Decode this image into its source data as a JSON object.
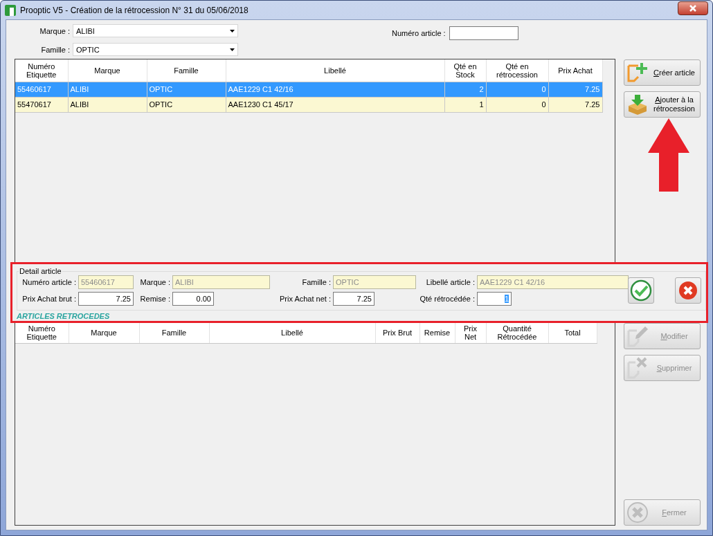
{
  "window": {
    "title": "Prooptic V5 - Création de la rétrocession N° 31 du 05/06/2018"
  },
  "filters": {
    "brand": {
      "label": "Marque :",
      "value": "ALIBI"
    },
    "family": {
      "label": "Famille :",
      "value": "OPTIC"
    },
    "article_number": {
      "label": "Numéro article :"
    }
  },
  "articles_table": {
    "columns": [
      {
        "label": "Numéro Etiquette",
        "kind": "text"
      },
      {
        "label": "Marque",
        "kind": "text"
      },
      {
        "label": "Famille",
        "kind": "text"
      },
      {
        "label": "Libellé",
        "kind": "text"
      },
      {
        "label": "Qté en Stock",
        "kind": "number"
      },
      {
        "label": "Qté en rétrocession",
        "kind": "number"
      },
      {
        "label": "Prix Achat",
        "kind": "number"
      }
    ],
    "rows": [
      {
        "selected": true,
        "cells": [
          "55460617",
          "ALIBI",
          "OPTIC",
          "AAE1229 C1 42/16",
          "2",
          "0",
          "7.25"
        ]
      },
      {
        "selected": false,
        "cells": [
          "55470617",
          "ALIBI",
          "OPTIC",
          "AAE1230 C1 45/17",
          "1",
          "0",
          "7.25"
        ]
      }
    ]
  },
  "top_actions": [
    {
      "kind": "create",
      "label": "Créer article",
      "disabled": false
    },
    {
      "kind": "add",
      "label": "Ajouter à la rétrocession",
      "disabled": false
    }
  ],
  "detail": {
    "title": "Detail article",
    "fields": [
      {
        "label": "Numéro article :",
        "value": "55460617",
        "readonly": true,
        "text_selected": false
      },
      {
        "label": "Marque :",
        "value": "ALIBI",
        "readonly": true,
        "text_selected": false
      },
      {
        "label": "Famille :",
        "value": "OPTIC",
        "readonly": true,
        "text_selected": false
      },
      {
        "label": "Libellé article :",
        "value": "AAE1229 C1 42/16",
        "readonly": true,
        "text_selected": false
      },
      {
        "label": "Prix Achat brut :",
        "value": "7.25",
        "readonly": false,
        "text_selected": false
      },
      {
        "label": "Remise :",
        "value": "0.00",
        "readonly": false,
        "text_selected": false
      },
      {
        "label": "Prix Achat net :",
        "value": "7.25",
        "readonly": false,
        "text_selected": false
      },
      {
        "label": "Qté rétrocédée :",
        "value": "1",
        "readonly": false,
        "text_selected": true
      }
    ]
  },
  "retro_heading": "ARTICLES RETROCEDES",
  "retro_table": {
    "columns": [
      "Numéro Etiquette",
      "Marque",
      "Famille",
      "Libellé",
      "Prix Brut",
      "Remise",
      "Prix Net",
      "Quantité Rétrocédée",
      "Total"
    ]
  },
  "bottom_actions": [
    {
      "kind": "modify",
      "label": "Modifier",
      "disabled": true
    },
    {
      "kind": "delete",
      "label": "Supprimer",
      "disabled": true
    }
  ],
  "close_action": {
    "kind": "close",
    "label": "Fermer",
    "disabled": true
  }
}
